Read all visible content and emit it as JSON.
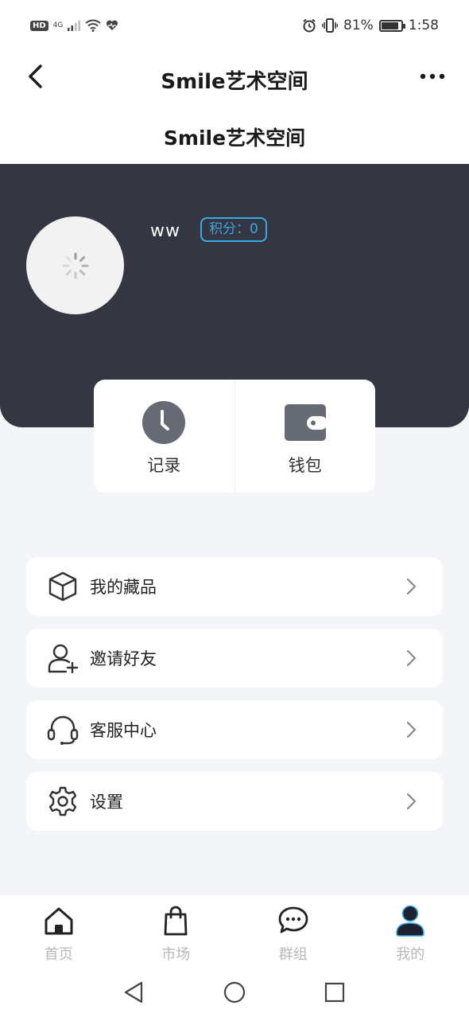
{
  "status_bar": {
    "hd": "HD",
    "network": "4G",
    "battery_pct": "81%",
    "time": "1:58"
  },
  "nav": {
    "title": "Smile艺术空间"
  },
  "subheader": {
    "title": "Smile艺术空间"
  },
  "profile": {
    "username": "ww",
    "points_label": "积分：0"
  },
  "quick_actions": [
    {
      "label": "记录",
      "icon": "clock-icon"
    },
    {
      "label": "钱包",
      "icon": "wallet-icon"
    }
  ],
  "menu": [
    {
      "label": "我的藏品",
      "icon": "box-icon"
    },
    {
      "label": "邀请好友",
      "icon": "add-user-icon"
    },
    {
      "label": "客服中心",
      "icon": "headset-icon"
    },
    {
      "label": "设置",
      "icon": "gear-icon"
    }
  ],
  "tabs": [
    {
      "label": "首页",
      "icon": "home-icon"
    },
    {
      "label": "市场",
      "icon": "shopping-bag-icon"
    },
    {
      "label": "群组",
      "icon": "chat-icon"
    },
    {
      "label": "我的",
      "icon": "user-icon",
      "active": true
    }
  ],
  "colors": {
    "hero_bg": "#343741",
    "accent": "#37a9e6",
    "page_bg": "#f4f5f9"
  }
}
